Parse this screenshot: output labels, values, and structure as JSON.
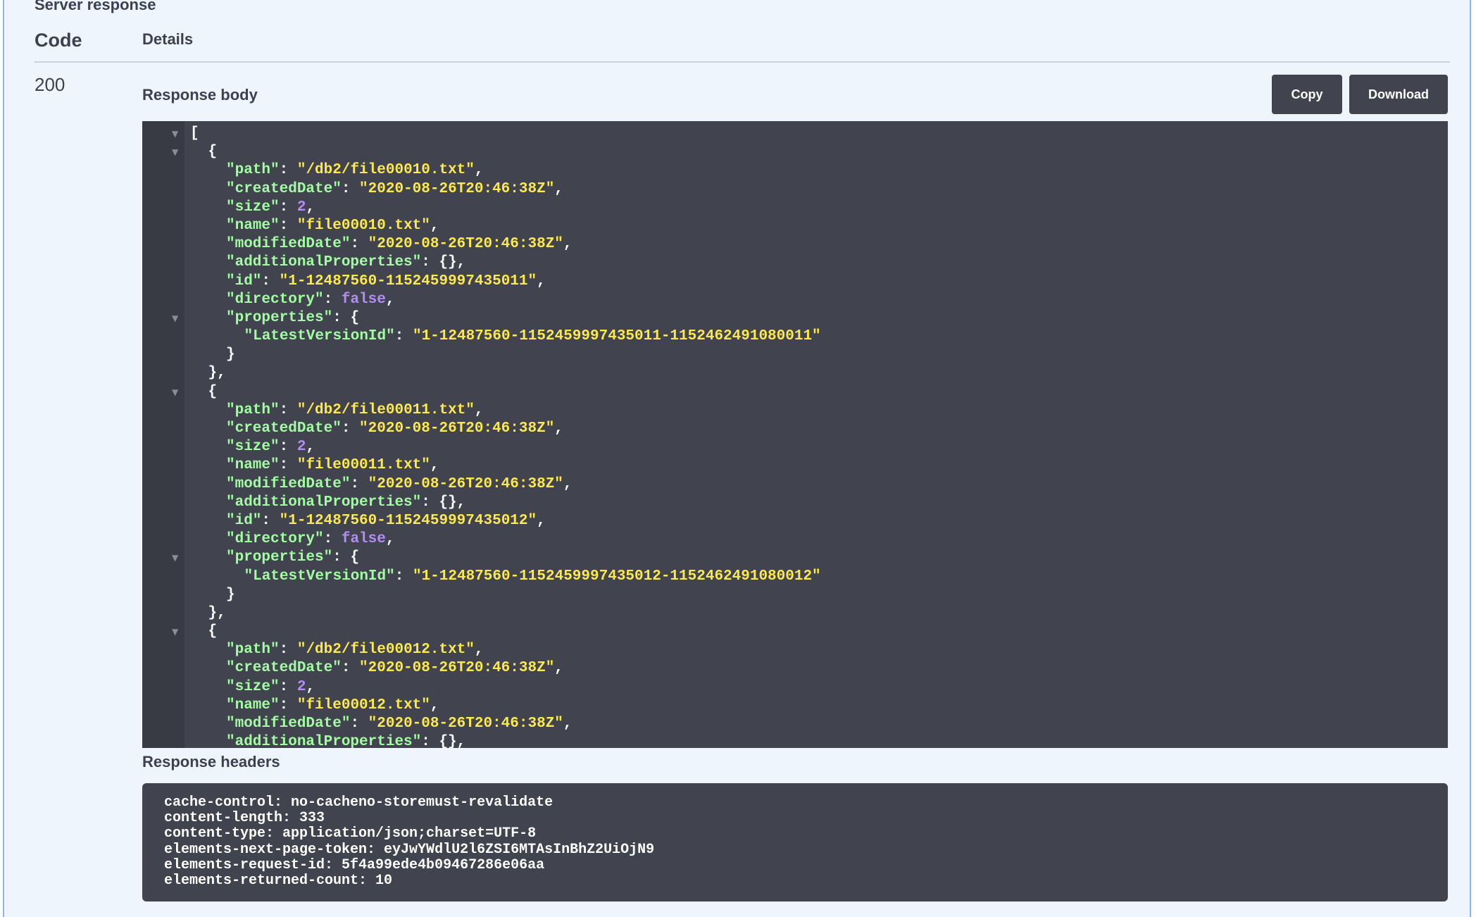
{
  "section_title": "Server response",
  "table": {
    "code_header": "Code",
    "details_header": "Details"
  },
  "status_code": "200",
  "response_body": {
    "label": "Response body",
    "copy_label": "Copy",
    "download_label": "Download",
    "lines": [
      {
        "fold": true,
        "indent": 0,
        "tokens": [
          {
            "t": "p",
            "v": "["
          }
        ]
      },
      {
        "fold": true,
        "indent": 1,
        "tokens": [
          {
            "t": "p",
            "v": "{"
          }
        ]
      },
      {
        "fold": false,
        "indent": 2,
        "tokens": [
          {
            "t": "k",
            "v": "\"path\""
          },
          {
            "t": "p",
            "v": ": "
          },
          {
            "t": "s",
            "v": "\"/db2/file00010.txt\""
          },
          {
            "t": "p",
            "v": ","
          }
        ]
      },
      {
        "fold": false,
        "indent": 2,
        "tokens": [
          {
            "t": "k",
            "v": "\"createdDate\""
          },
          {
            "t": "p",
            "v": ": "
          },
          {
            "t": "s",
            "v": "\"2020-08-26T20:46:38Z\""
          },
          {
            "t": "p",
            "v": ","
          }
        ]
      },
      {
        "fold": false,
        "indent": 2,
        "tokens": [
          {
            "t": "k",
            "v": "\"size\""
          },
          {
            "t": "p",
            "v": ": "
          },
          {
            "t": "n",
            "v": "2"
          },
          {
            "t": "p",
            "v": ","
          }
        ]
      },
      {
        "fold": false,
        "indent": 2,
        "tokens": [
          {
            "t": "k",
            "v": "\"name\""
          },
          {
            "t": "p",
            "v": ": "
          },
          {
            "t": "s",
            "v": "\"file00010.txt\""
          },
          {
            "t": "p",
            "v": ","
          }
        ]
      },
      {
        "fold": false,
        "indent": 2,
        "tokens": [
          {
            "t": "k",
            "v": "\"modifiedDate\""
          },
          {
            "t": "p",
            "v": ": "
          },
          {
            "t": "s",
            "v": "\"2020-08-26T20:46:38Z\""
          },
          {
            "t": "p",
            "v": ","
          }
        ]
      },
      {
        "fold": false,
        "indent": 2,
        "tokens": [
          {
            "t": "k",
            "v": "\"additionalProperties\""
          },
          {
            "t": "p",
            "v": ": {},"
          }
        ]
      },
      {
        "fold": false,
        "indent": 2,
        "tokens": [
          {
            "t": "k",
            "v": "\"id\""
          },
          {
            "t": "p",
            "v": ": "
          },
          {
            "t": "s",
            "v": "\"1-12487560-1152459997435011\""
          },
          {
            "t": "p",
            "v": ","
          }
        ]
      },
      {
        "fold": false,
        "indent": 2,
        "tokens": [
          {
            "t": "k",
            "v": "\"directory\""
          },
          {
            "t": "p",
            "v": ": "
          },
          {
            "t": "b",
            "v": "false"
          },
          {
            "t": "p",
            "v": ","
          }
        ]
      },
      {
        "fold": true,
        "indent": 2,
        "tokens": [
          {
            "t": "k",
            "v": "\"properties\""
          },
          {
            "t": "p",
            "v": ": {"
          }
        ]
      },
      {
        "fold": false,
        "indent": 3,
        "tokens": [
          {
            "t": "k",
            "v": "\"LatestVersionId\""
          },
          {
            "t": "p",
            "v": ": "
          },
          {
            "t": "s",
            "v": "\"1-12487560-1152459997435011-1152462491080011\""
          }
        ]
      },
      {
        "fold": false,
        "indent": 2,
        "tokens": [
          {
            "t": "p",
            "v": "}"
          }
        ]
      },
      {
        "fold": false,
        "indent": 1,
        "tokens": [
          {
            "t": "p",
            "v": "},"
          }
        ]
      },
      {
        "fold": true,
        "indent": 1,
        "tokens": [
          {
            "t": "p",
            "v": "{"
          }
        ]
      },
      {
        "fold": false,
        "indent": 2,
        "tokens": [
          {
            "t": "k",
            "v": "\"path\""
          },
          {
            "t": "p",
            "v": ": "
          },
          {
            "t": "s",
            "v": "\"/db2/file00011.txt\""
          },
          {
            "t": "p",
            "v": ","
          }
        ]
      },
      {
        "fold": false,
        "indent": 2,
        "tokens": [
          {
            "t": "k",
            "v": "\"createdDate\""
          },
          {
            "t": "p",
            "v": ": "
          },
          {
            "t": "s",
            "v": "\"2020-08-26T20:46:38Z\""
          },
          {
            "t": "p",
            "v": ","
          }
        ]
      },
      {
        "fold": false,
        "indent": 2,
        "tokens": [
          {
            "t": "k",
            "v": "\"size\""
          },
          {
            "t": "p",
            "v": ": "
          },
          {
            "t": "n",
            "v": "2"
          },
          {
            "t": "p",
            "v": ","
          }
        ]
      },
      {
        "fold": false,
        "indent": 2,
        "tokens": [
          {
            "t": "k",
            "v": "\"name\""
          },
          {
            "t": "p",
            "v": ": "
          },
          {
            "t": "s",
            "v": "\"file00011.txt\""
          },
          {
            "t": "p",
            "v": ","
          }
        ]
      },
      {
        "fold": false,
        "indent": 2,
        "tokens": [
          {
            "t": "k",
            "v": "\"modifiedDate\""
          },
          {
            "t": "p",
            "v": ": "
          },
          {
            "t": "s",
            "v": "\"2020-08-26T20:46:38Z\""
          },
          {
            "t": "p",
            "v": ","
          }
        ]
      },
      {
        "fold": false,
        "indent": 2,
        "tokens": [
          {
            "t": "k",
            "v": "\"additionalProperties\""
          },
          {
            "t": "p",
            "v": ": {},"
          }
        ]
      },
      {
        "fold": false,
        "indent": 2,
        "tokens": [
          {
            "t": "k",
            "v": "\"id\""
          },
          {
            "t": "p",
            "v": ": "
          },
          {
            "t": "s",
            "v": "\"1-12487560-1152459997435012\""
          },
          {
            "t": "p",
            "v": ","
          }
        ]
      },
      {
        "fold": false,
        "indent": 2,
        "tokens": [
          {
            "t": "k",
            "v": "\"directory\""
          },
          {
            "t": "p",
            "v": ": "
          },
          {
            "t": "b",
            "v": "false"
          },
          {
            "t": "p",
            "v": ","
          }
        ]
      },
      {
        "fold": true,
        "indent": 2,
        "tokens": [
          {
            "t": "k",
            "v": "\"properties\""
          },
          {
            "t": "p",
            "v": ": {"
          }
        ]
      },
      {
        "fold": false,
        "indent": 3,
        "tokens": [
          {
            "t": "k",
            "v": "\"LatestVersionId\""
          },
          {
            "t": "p",
            "v": ": "
          },
          {
            "t": "s",
            "v": "\"1-12487560-1152459997435012-1152462491080012\""
          }
        ]
      },
      {
        "fold": false,
        "indent": 2,
        "tokens": [
          {
            "t": "p",
            "v": "}"
          }
        ]
      },
      {
        "fold": false,
        "indent": 1,
        "tokens": [
          {
            "t": "p",
            "v": "},"
          }
        ]
      },
      {
        "fold": true,
        "indent": 1,
        "tokens": [
          {
            "t": "p",
            "v": "{"
          }
        ]
      },
      {
        "fold": false,
        "indent": 2,
        "tokens": [
          {
            "t": "k",
            "v": "\"path\""
          },
          {
            "t": "p",
            "v": ": "
          },
          {
            "t": "s",
            "v": "\"/db2/file00012.txt\""
          },
          {
            "t": "p",
            "v": ","
          }
        ]
      },
      {
        "fold": false,
        "indent": 2,
        "tokens": [
          {
            "t": "k",
            "v": "\"createdDate\""
          },
          {
            "t": "p",
            "v": ": "
          },
          {
            "t": "s",
            "v": "\"2020-08-26T20:46:38Z\""
          },
          {
            "t": "p",
            "v": ","
          }
        ]
      },
      {
        "fold": false,
        "indent": 2,
        "tokens": [
          {
            "t": "k",
            "v": "\"size\""
          },
          {
            "t": "p",
            "v": ": "
          },
          {
            "t": "n",
            "v": "2"
          },
          {
            "t": "p",
            "v": ","
          }
        ]
      },
      {
        "fold": false,
        "indent": 2,
        "tokens": [
          {
            "t": "k",
            "v": "\"name\""
          },
          {
            "t": "p",
            "v": ": "
          },
          {
            "t": "s",
            "v": "\"file00012.txt\""
          },
          {
            "t": "p",
            "v": ","
          }
        ]
      },
      {
        "fold": false,
        "indent": 2,
        "tokens": [
          {
            "t": "k",
            "v": "\"modifiedDate\""
          },
          {
            "t": "p",
            "v": ": "
          },
          {
            "t": "s",
            "v": "\"2020-08-26T20:46:38Z\""
          },
          {
            "t": "p",
            "v": ","
          }
        ]
      },
      {
        "fold": false,
        "indent": 2,
        "tokens": [
          {
            "t": "k",
            "v": "\"additionalProperties\""
          },
          {
            "t": "p",
            "v": ": {},"
          }
        ]
      }
    ]
  },
  "response_headers": {
    "label": "Response headers",
    "lines": [
      "cache-control: no-cacheno-storemust-revalidate",
      "content-length: 333",
      "content-type: application/json;charset=UTF-8",
      "elements-next-page-token: eyJwYWdlU2l6ZSI6MTAsInBhZ2UiOjN9",
      "elements-request-id: 5f4a99ede4b09467286e06aa",
      "elements-returned-count: 10"
    ]
  },
  "colors": {
    "panel_bg": "#eef5fd",
    "code_bg": "#41444e",
    "json_key": "#a2fca2",
    "json_string": "#fce94f",
    "json_number_bool": "#b48cf7",
    "button_bg": "#41444e"
  },
  "icons": {
    "fold": "triangle-down"
  }
}
